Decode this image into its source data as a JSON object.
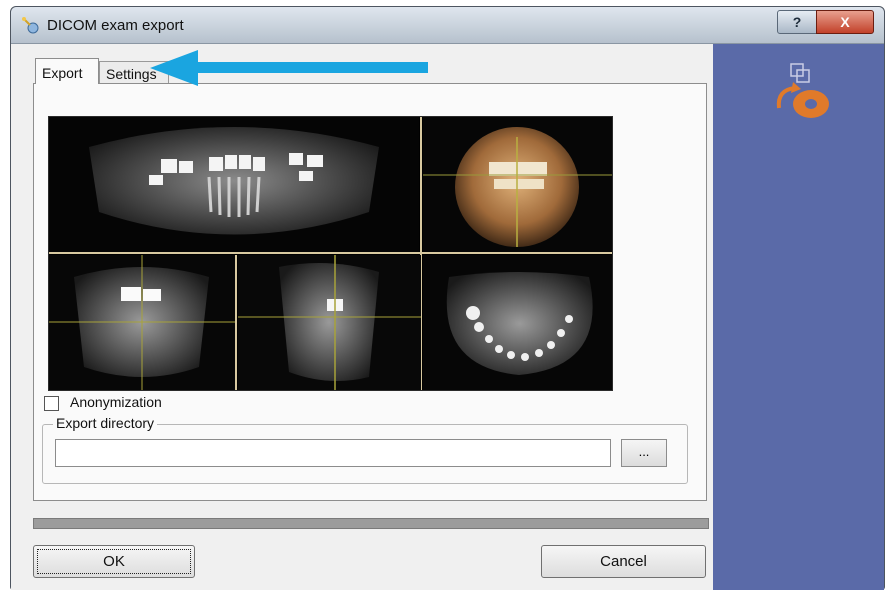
{
  "window": {
    "title": "DICOM exam export",
    "help_label": "?",
    "close_label": "X"
  },
  "tabs": [
    {
      "label": "Export",
      "active": true
    },
    {
      "label": "Settings",
      "active": false
    }
  ],
  "export": {
    "anonymization_label": "Anonymization",
    "anonymization_checked": false,
    "export_directory_label": "Export directory",
    "export_directory_value": "",
    "browse_label": "..."
  },
  "progress": {
    "value": 0
  },
  "buttons": {
    "ok_label": "OK",
    "cancel_label": "Cancel"
  },
  "icons": {
    "app": "dicom-app-icon",
    "export": "export-disc-icon",
    "annotation": "pointer-arrow-icon"
  },
  "colors": {
    "right_panel": "#5a6aa8",
    "arrow": "#1aa5e0",
    "export_icon": "#e07a2a"
  }
}
